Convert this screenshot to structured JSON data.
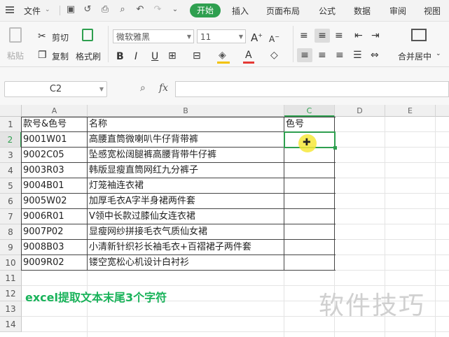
{
  "menu": {
    "file": "文件",
    "tabs": [
      "开始",
      "插入",
      "页面布局",
      "公式",
      "数据",
      "审阅",
      "视图"
    ],
    "active_color": "#2e9f4f"
  },
  "ribbon": {
    "paste": "粘贴",
    "cut": "剪切",
    "copy": "复制",
    "format_painter": "格式刷",
    "font_name": "微软雅黑",
    "font_size": "11",
    "bold": "B",
    "italic": "I",
    "underline": "U",
    "font_color_glyph": "A",
    "merge_center": "合并居中"
  },
  "formula_bar": {
    "name_box": "C2",
    "fx": "fx",
    "formula": ""
  },
  "sheet": {
    "columns": [
      "A",
      "B",
      "C",
      "D",
      "E"
    ],
    "rows": [
      "1",
      "2",
      "3",
      "4",
      "5",
      "6",
      "7",
      "8",
      "9",
      "10",
      "11",
      "12",
      "13",
      "14"
    ],
    "header": {
      "a": "款号&色号",
      "b": "名称",
      "c": "色号"
    },
    "data": [
      {
        "a": "9001W01",
        "b": "高腰直筒微喇叭牛仔背带裤"
      },
      {
        "a": "9002C05",
        "b": "坠感宽松阔腿裤高腰背带牛仔裤"
      },
      {
        "a": "9003R03",
        "b": "韩版显瘦直筒网红九分裤子"
      },
      {
        "a": "9004B01",
        "b": "灯笼袖连衣裙"
      },
      {
        "a": "9005W02",
        "b": "加厚毛衣A字半身裙两件套"
      },
      {
        "a": "9006R01",
        "b": "V领中长款过膝仙女连衣裙"
      },
      {
        "a": "9007P02",
        "b": "显瘦网纱拼接毛衣气质仙女裙"
      },
      {
        "a": "9008B03",
        "b": "小清新针织衫长袖毛衣+百褶裙子两件套"
      },
      {
        "a": "9009R02",
        "b": "镂空宽松心机设计白衬衫"
      }
    ],
    "note": "excel提取文本末尾3个字符",
    "note_color": "#19b35a",
    "watermark": "软件技巧"
  }
}
